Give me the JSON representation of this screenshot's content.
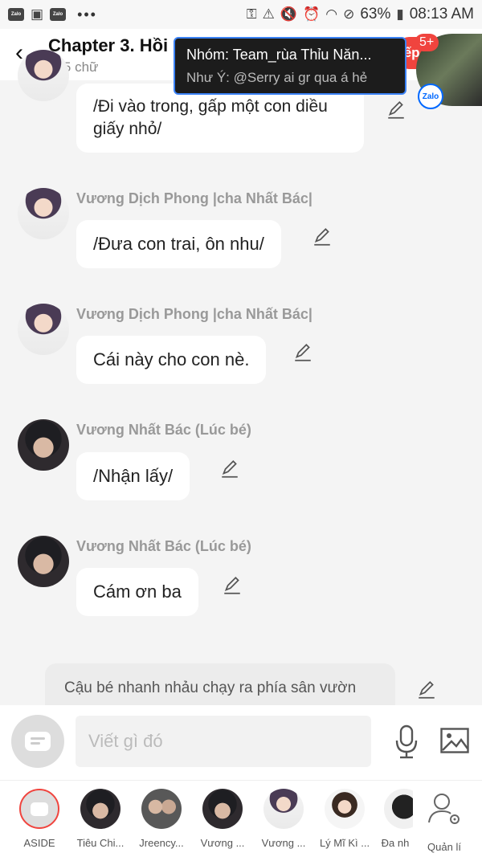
{
  "status_bar": {
    "battery": "63%",
    "time": "08:13 AM",
    "app_icons": [
      "Zalo",
      "Zalo"
    ],
    "overflow": "•••"
  },
  "header": {
    "title": "Chapter 3. Hồi",
    "subtitle": "305 chữ",
    "next_label": "iếp",
    "badge": "5+"
  },
  "notification": {
    "title": "Nhóm: Team_rùa Thỉu Năn...",
    "body": "Như Ý: @Serry ai gr qua á hẻ",
    "app_tag": "Zalo"
  },
  "messages": [
    {
      "sender": "",
      "text": "/Đi vào trong, gấp một con diều giấy nhỏ/",
      "avatar": "anime"
    },
    {
      "sender": "Vương Dịch Phong |cha Nhất Bác|",
      "text": "/Đưa con trai, ôn nhu/",
      "avatar": "anime"
    },
    {
      "sender": "Vương Dịch Phong |cha Nhất Bác|",
      "text": "Cái này cho con nè.",
      "avatar": "anime"
    },
    {
      "sender": "Vương Nhất Bác (Lúc bé)",
      "text": "/Nhận lấy/",
      "avatar": "real"
    },
    {
      "sender": "Vương Nhất Bác (Lúc bé)",
      "text": "Cám ơn ba",
      "avatar": "real"
    }
  ],
  "narration": {
    "text": "Cậu bé nhanh nhảu chạy ra phía sân vườn"
  },
  "input": {
    "placeholder": "Viết gì đó"
  },
  "characters": [
    {
      "label": "ASIDE"
    },
    {
      "label": "Tiêu Chi..."
    },
    {
      "label": "Jreency..."
    },
    {
      "label": "Vương ..."
    },
    {
      "label": "Vương ..."
    },
    {
      "label": "Lý Mĩ Kì ..."
    },
    {
      "label": "Đa nh"
    },
    {
      "label": "Quản lí"
    }
  ],
  "colors": {
    "accent": "#f0443e",
    "zalo_blue": "#0068ff",
    "background": "#f4f4f4"
  }
}
